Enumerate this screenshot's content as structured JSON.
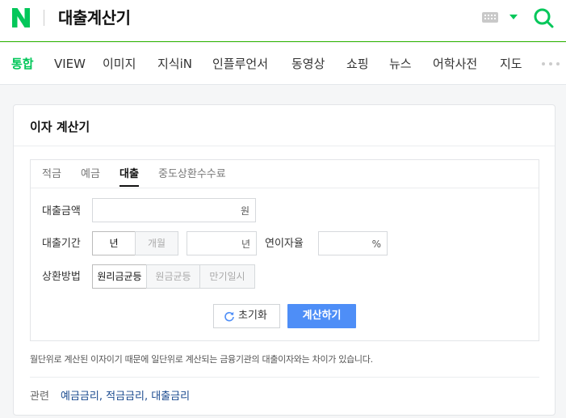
{
  "header": {
    "query": "대출계산기"
  },
  "nav": {
    "tabs": [
      "통합",
      "VIEW",
      "이미지",
      "지식iN",
      "인플루언서",
      "동영상",
      "쇼핑",
      "뉴스",
      "어학사전",
      "지도"
    ]
  },
  "card": {
    "title": "이자 계산기",
    "subtabs": [
      "적금",
      "예금",
      "대출",
      "중도상환수수료"
    ],
    "active_subtab": "대출",
    "amount": {
      "label": "대출금액",
      "value": "",
      "unit": "원"
    },
    "period": {
      "label": "대출기간",
      "unit_options": [
        "년",
        "개월"
      ],
      "selected_unit": "년",
      "value": "",
      "unit": "년"
    },
    "rate": {
      "label": "연이자율",
      "value": "",
      "unit": "%"
    },
    "method": {
      "label": "상환방법",
      "options": [
        "원리금균등",
        "원금균등",
        "만기일시"
      ],
      "selected": "원리금균등"
    },
    "reset_label": "초기화",
    "calc_label": "계산하기",
    "note": "월단위로 계산된 이자이기 때문에 일단위로 계산되는 금융기관의 대출이자와는 차이가 있습니다.",
    "related": {
      "label": "관련",
      "links": [
        "예금금리",
        "적금금리",
        "대출금리"
      ]
    }
  },
  "colors": {
    "brand": "#03c75a",
    "primary_button": "#4e8ef7",
    "link": "#1a4a8f"
  },
  "icons": [
    "naver-logo-icon",
    "keyboard-icon",
    "dropdown-arrow-icon",
    "search-icon",
    "more-icon",
    "reset-icon"
  ]
}
